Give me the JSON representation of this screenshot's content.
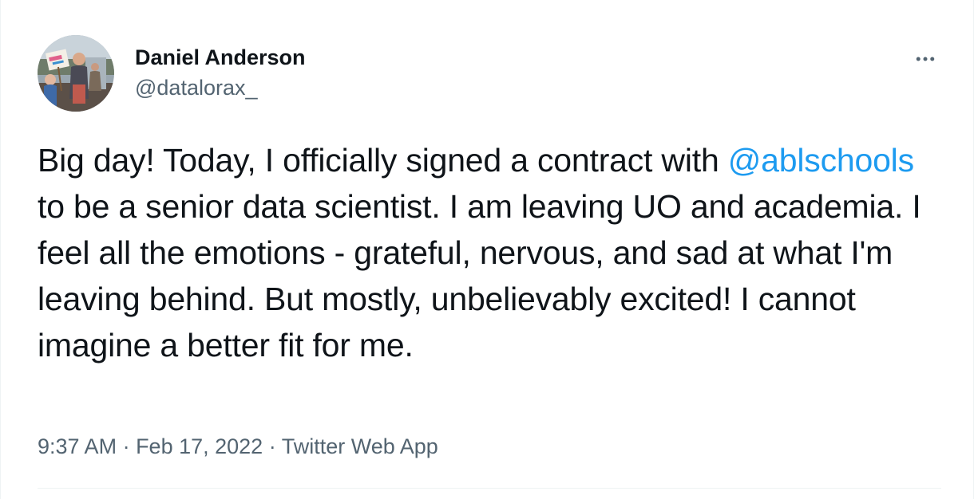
{
  "author": {
    "display_name": "Daniel Anderson",
    "handle": "@datalorax_",
    "avatar_sign_text": "Strong Good"
  },
  "more_icon": "more-horizontal-icon",
  "tweet": {
    "text_before_mention": "Big day! Today, I officially signed a contract with ",
    "mention": "@ablschools",
    "text_after_mention": " to be a senior data scientist. I am leaving UO and academia. I feel all the emotions - grateful, nervous, and sad at what I'm leaving behind. But mostly, unbelievably excited! I cannot imagine a better fit for me."
  },
  "meta": {
    "time": "9:37 AM",
    "separator": " · ",
    "date": "Feb 17, 2022",
    "source": "Twitter Web App"
  },
  "colors": {
    "link": "#1d9bf0",
    "secondary_text": "#536471",
    "primary_text": "#0f1419",
    "divider": "#eff3f4"
  }
}
